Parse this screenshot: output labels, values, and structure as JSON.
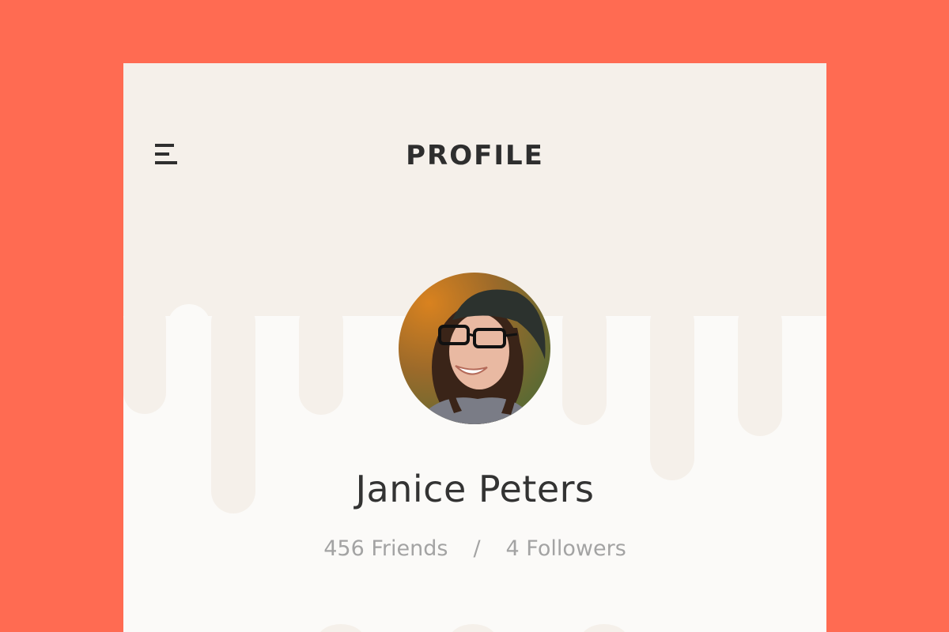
{
  "colors": {
    "background": "#FF6B52",
    "card": "#FBFAF8",
    "header_band": "#F5F0EA",
    "title_text": "#2E2E2E",
    "stats_text": "#A3A3A3"
  },
  "header": {
    "menu_icon": "hamburger-menu-icon",
    "title": "PROFILE"
  },
  "profile": {
    "avatar": "profile-photo",
    "name": "Janice Peters",
    "friends": "456 Friends",
    "separator": "/",
    "followers": "4 Followers"
  }
}
